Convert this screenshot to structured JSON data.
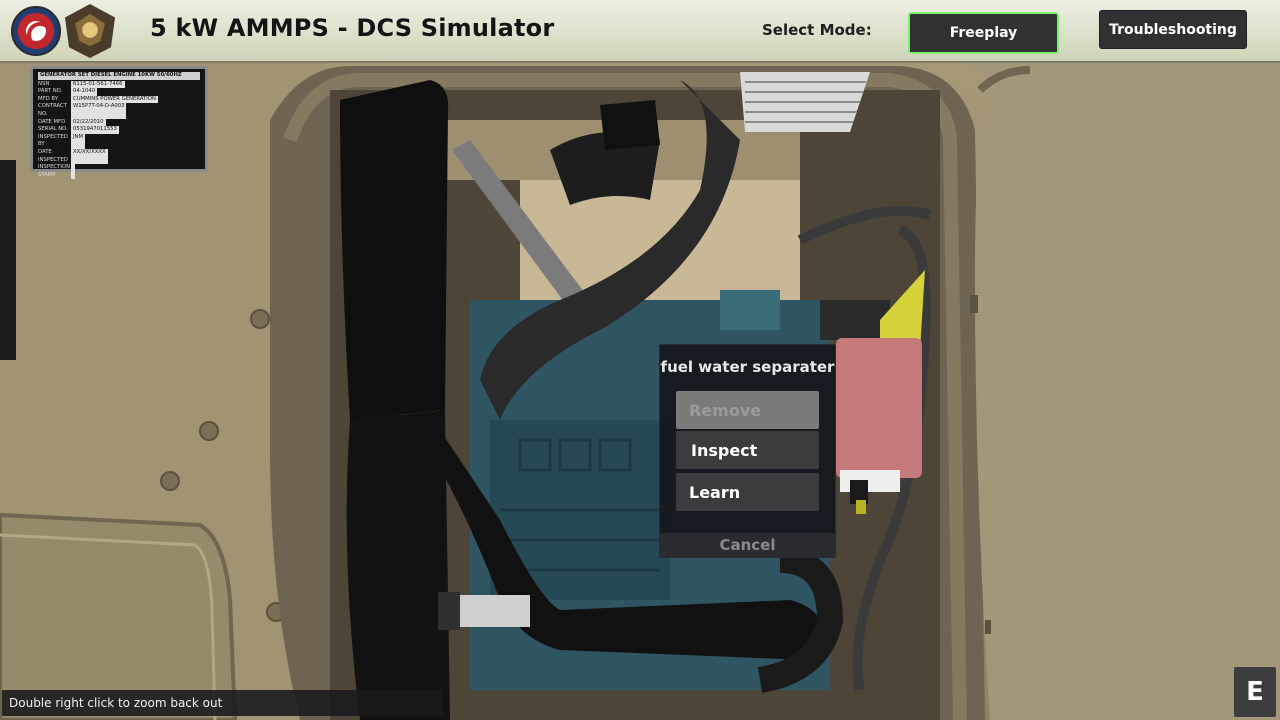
{
  "header": {
    "title": "5 kW AMMPS - DCS Simulator",
    "mode_label": "Select Mode:",
    "freeplay_label": "Freeplay",
    "troubleshooting_label": "Troubleshooting",
    "active_mode": "Freeplay",
    "active_color": "#7ef06a"
  },
  "nameplate": {
    "title": "GENERATOR SET DIESEL ENGINE 10KW 50/60HZ",
    "rows": [
      {
        "key": "NSN",
        "value": "6115-01-561-7466"
      },
      {
        "key": "PART NO.",
        "value": "04-1040"
      },
      {
        "key": "MFD BY",
        "value": "CUMMINS POWER GENERATION"
      },
      {
        "key": "CONTRACT NO.",
        "value": "W15P7T-04-D-A003"
      },
      {
        "key": "DATE MFD",
        "value": "02/22/2010"
      },
      {
        "key": "SERIAL NO.",
        "value": "0531947011553"
      },
      {
        "key": "INSPECTED BY",
        "value": "JNM"
      },
      {
        "key": "DATE INSPECTED",
        "value": "XX/XX/XXXX"
      },
      {
        "key": "INSPECTION STAMP",
        "value": ""
      }
    ]
  },
  "context_menu": {
    "title": "fuel water separater",
    "remove_label": "Remove",
    "inspect_label": "Inspect",
    "learn_label": "Learn",
    "cancel_label": "Cancel"
  },
  "status": {
    "hint": "Double right click to zoom back out",
    "key_hint": "E"
  }
}
